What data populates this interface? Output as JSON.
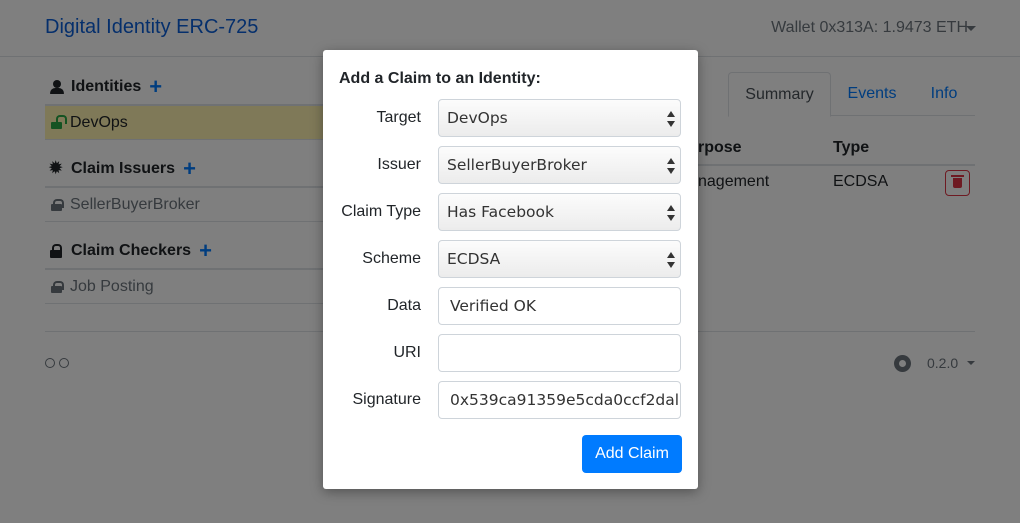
{
  "navbar": {
    "brand": "Digital Identity ERC-725",
    "wallet": "Wallet 0x313A: 1.9473 ETH"
  },
  "sidebar": {
    "identities": {
      "heading": "Identities",
      "add": "+",
      "items": [
        "DevOps"
      ]
    },
    "claim_issuers": {
      "heading": "Claim Issuers",
      "add": "+",
      "items": [
        "SellerBuyerBroker"
      ]
    },
    "claim_checkers": {
      "heading": "Claim Checkers",
      "add": "+",
      "items": [
        "Job Posting"
      ]
    }
  },
  "tabs": [
    "Summary",
    "Events",
    "Info"
  ],
  "table": {
    "headers": [
      "rpose",
      "Type"
    ],
    "rows": [
      [
        "nagement",
        "ECDSA"
      ]
    ]
  },
  "footer": {
    "version": "0.2.0"
  },
  "modal": {
    "title": "Add a Claim to an Identity:",
    "fields": {
      "target": {
        "label": "Target",
        "value": "DevOps"
      },
      "issuer": {
        "label": "Issuer",
        "value": "SellerBuyerBroker"
      },
      "claim_type": {
        "label": "Claim Type",
        "value": "Has Facebook"
      },
      "scheme": {
        "label": "Scheme",
        "value": "ECDSA"
      },
      "data": {
        "label": "Data",
        "value": "Verified OK"
      },
      "uri": {
        "label": "URI",
        "value": ""
      },
      "signature": {
        "label": "Signature",
        "value": "0x539ca91359e5cda0ccf2dal"
      }
    },
    "submit": "Add Claim"
  }
}
